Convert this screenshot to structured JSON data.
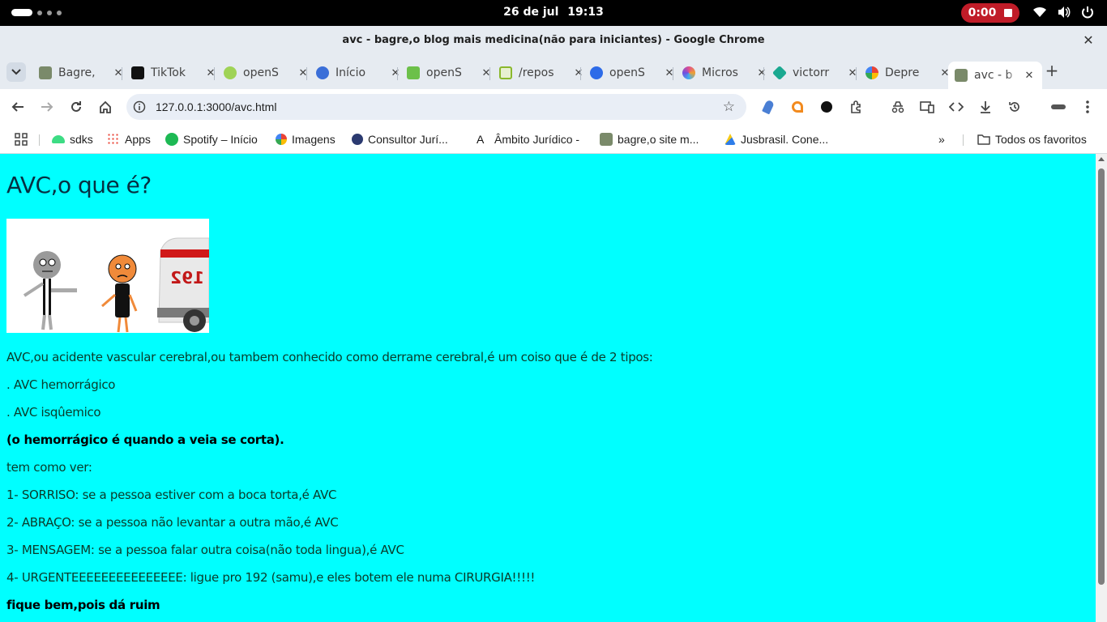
{
  "system": {
    "clock": {
      "date": "26 de jul",
      "time": "19:13"
    },
    "recording": "0:00"
  },
  "window": {
    "title": "avc - bagre,o blog mais medicina(não para iniciantes) - Google Chrome"
  },
  "tabs": [
    {
      "label": "Bagre,",
      "icon": "bagre-favicon"
    },
    {
      "label": "TikTok",
      "icon": "tiktok-favicon"
    },
    {
      "label": "openS",
      "icon": "opens-favicon"
    },
    {
      "label": "Início",
      "icon": "inicio-favicon"
    },
    {
      "label": "openS",
      "icon": "opens-favicon"
    },
    {
      "label": "/repos",
      "icon": "repos-favicon"
    },
    {
      "label": "openS",
      "icon": "opens-favicon"
    },
    {
      "label": "Micros",
      "icon": "copilot-favicon"
    },
    {
      "label": "victorr",
      "icon": "victor-favicon"
    },
    {
      "label": "Depre",
      "icon": "google-favicon"
    },
    {
      "label": "avc - b",
      "icon": "bagre-favicon",
      "active": true
    }
  ],
  "toolbar": {
    "url": "127.0.0.1:3000/avc.html"
  },
  "bookmarks": {
    "items": [
      {
        "label": "sdks",
        "icon": "android-icon"
      },
      {
        "label": "Apps",
        "icon": "apps-grid-icon"
      },
      {
        "label": "Spotify – Início",
        "icon": "spotify-icon"
      },
      {
        "label": "Imagens",
        "icon": "google-icon"
      },
      {
        "label": "Consultor Jurí...",
        "icon": "consultor-icon"
      },
      {
        "label": "Âmbito Jurídico -",
        "icon": "ambito-icon"
      },
      {
        "label": "bagre,o site m...",
        "icon": "bagre-favicon"
      },
      {
        "label": "Jusbrasil. Cone...",
        "icon": "jusbrasil-icon"
      }
    ],
    "more": "»",
    "all_favorites": "Todos os favoritos"
  },
  "page": {
    "heading": "AVC,o que é?",
    "intro": "AVC,ou acidente vascular cerebral,ou tambem conhecido como derrame cerebral,é um coiso que é de 2 tipos:",
    "type1": ". AVC hemorrágico",
    "type2": ". AVC isqûemico",
    "note": "(o hemorrágico é quando a veia se corta).",
    "how_to": "tem como ver:",
    "step1": "1- SORRISO: se a pessoa estiver com a boca torta,é AVC",
    "step2": "2- ABRAÇO: se a pessoa não levantar a outra mão,é AVC",
    "step3": "3- MENSAGEM: se a pessoa falar outra coisa(não toda lingua),é AVC",
    "step4": "4- URGENTEEEEEEEEEEEEEEE: ligue pro 192 (samu),e eles botem ele numa CIRURGIA!!!!!",
    "closing": "fique bem,pois dá ruim",
    "image_van_text": "192"
  },
  "colors": {
    "page_bg": "#00ffff",
    "recording": "#c01c28",
    "chrome_frame": "#e6ebf1"
  }
}
